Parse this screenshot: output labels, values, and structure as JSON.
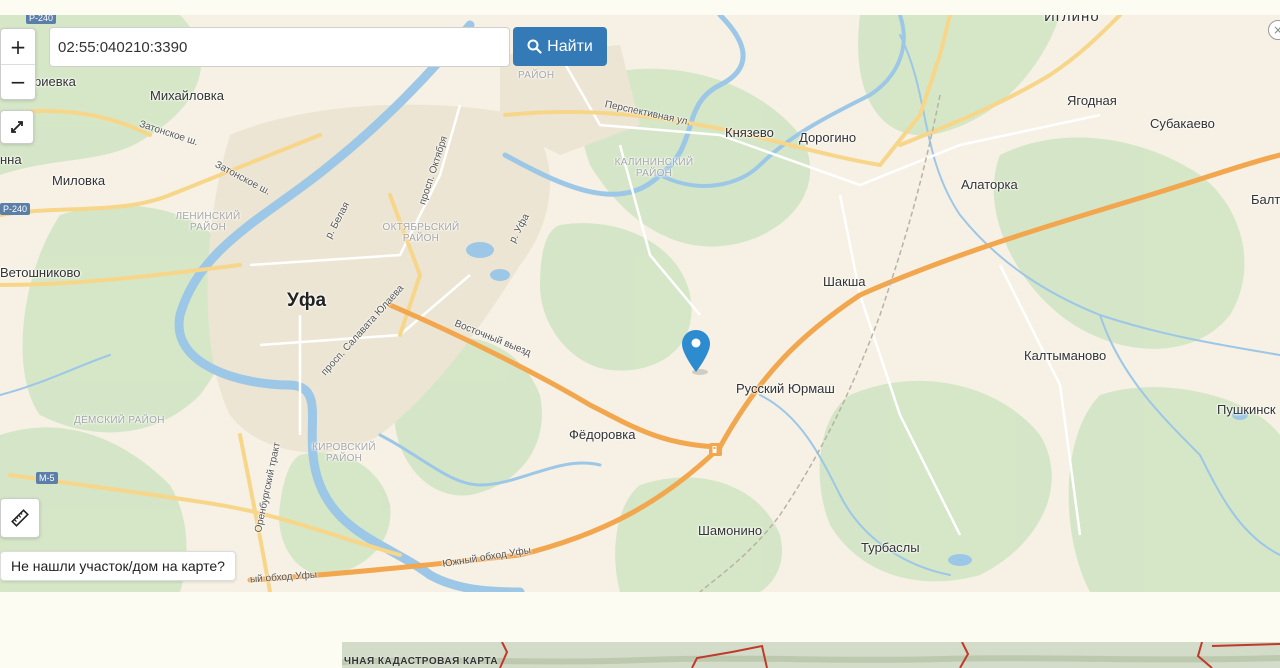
{
  "search": {
    "value": "02:55:040210:3390",
    "button_label": "Найти",
    "icon": "search-icon"
  },
  "controls": {
    "zoom_in": "+",
    "zoom_out": "−",
    "fullscreen_icon": "expand-icon",
    "ruler_icon": "ruler-icon",
    "close_icon": "close-icon",
    "close_symbol": "×",
    "not_found_label": "Не нашли участок/дом на карте?"
  },
  "map": {
    "city": "Уфа",
    "places": [
      "Иглино",
      "Михайловка",
      "Миловка",
      "Ветошниково",
      "Князево",
      "Дорогино",
      "Ягодная",
      "Субакаево",
      "Алаторка",
      "Шакша",
      "Калтыманово",
      "Русский Юрмаш",
      "Фёдоровка",
      "Шамонино",
      "Турбаслы",
      "Пушкинск",
      "Балт",
      "риевка",
      "нна"
    ],
    "districts": {
      "lenin": "Ленинский район",
      "oktyabr": "Октябрьский район",
      "kalinin": "Калининский район",
      "demsky": "Дёмский район",
      "kirov": "Кировский район",
      "top": "район"
    },
    "roads": {
      "zatonskoe1": "Затонское ш.",
      "zatonskoe2": "Затонское ш.",
      "belaya": "р. Белая",
      "ufa_river": "р. Уфа",
      "oktyabrya": "просп. Октября",
      "yulaeva": "просп. Салавата Юлаева",
      "vostochny": "Восточный выезд",
      "perspektivnaya": "Перспективная ул.",
      "orenburg": "Оренбургский тракт",
      "south_bypass": "Южный обход Уфы",
      "south_bypass2": "ый обход Уфы"
    },
    "shields": {
      "r240_top": "Р-240",
      "r240_left": "Р-240",
      "m5": "М-5"
    },
    "poi_icon": "fuel-station-icon",
    "marker_icon": "location-pin-icon",
    "accent_color": "#337ab7",
    "marker_color": "#2d8bd0",
    "highway_color": "#f2a64d"
  },
  "cadastral": {
    "title": "ЧНАЯ КАДАСТРОВАЯ КАРТА"
  }
}
